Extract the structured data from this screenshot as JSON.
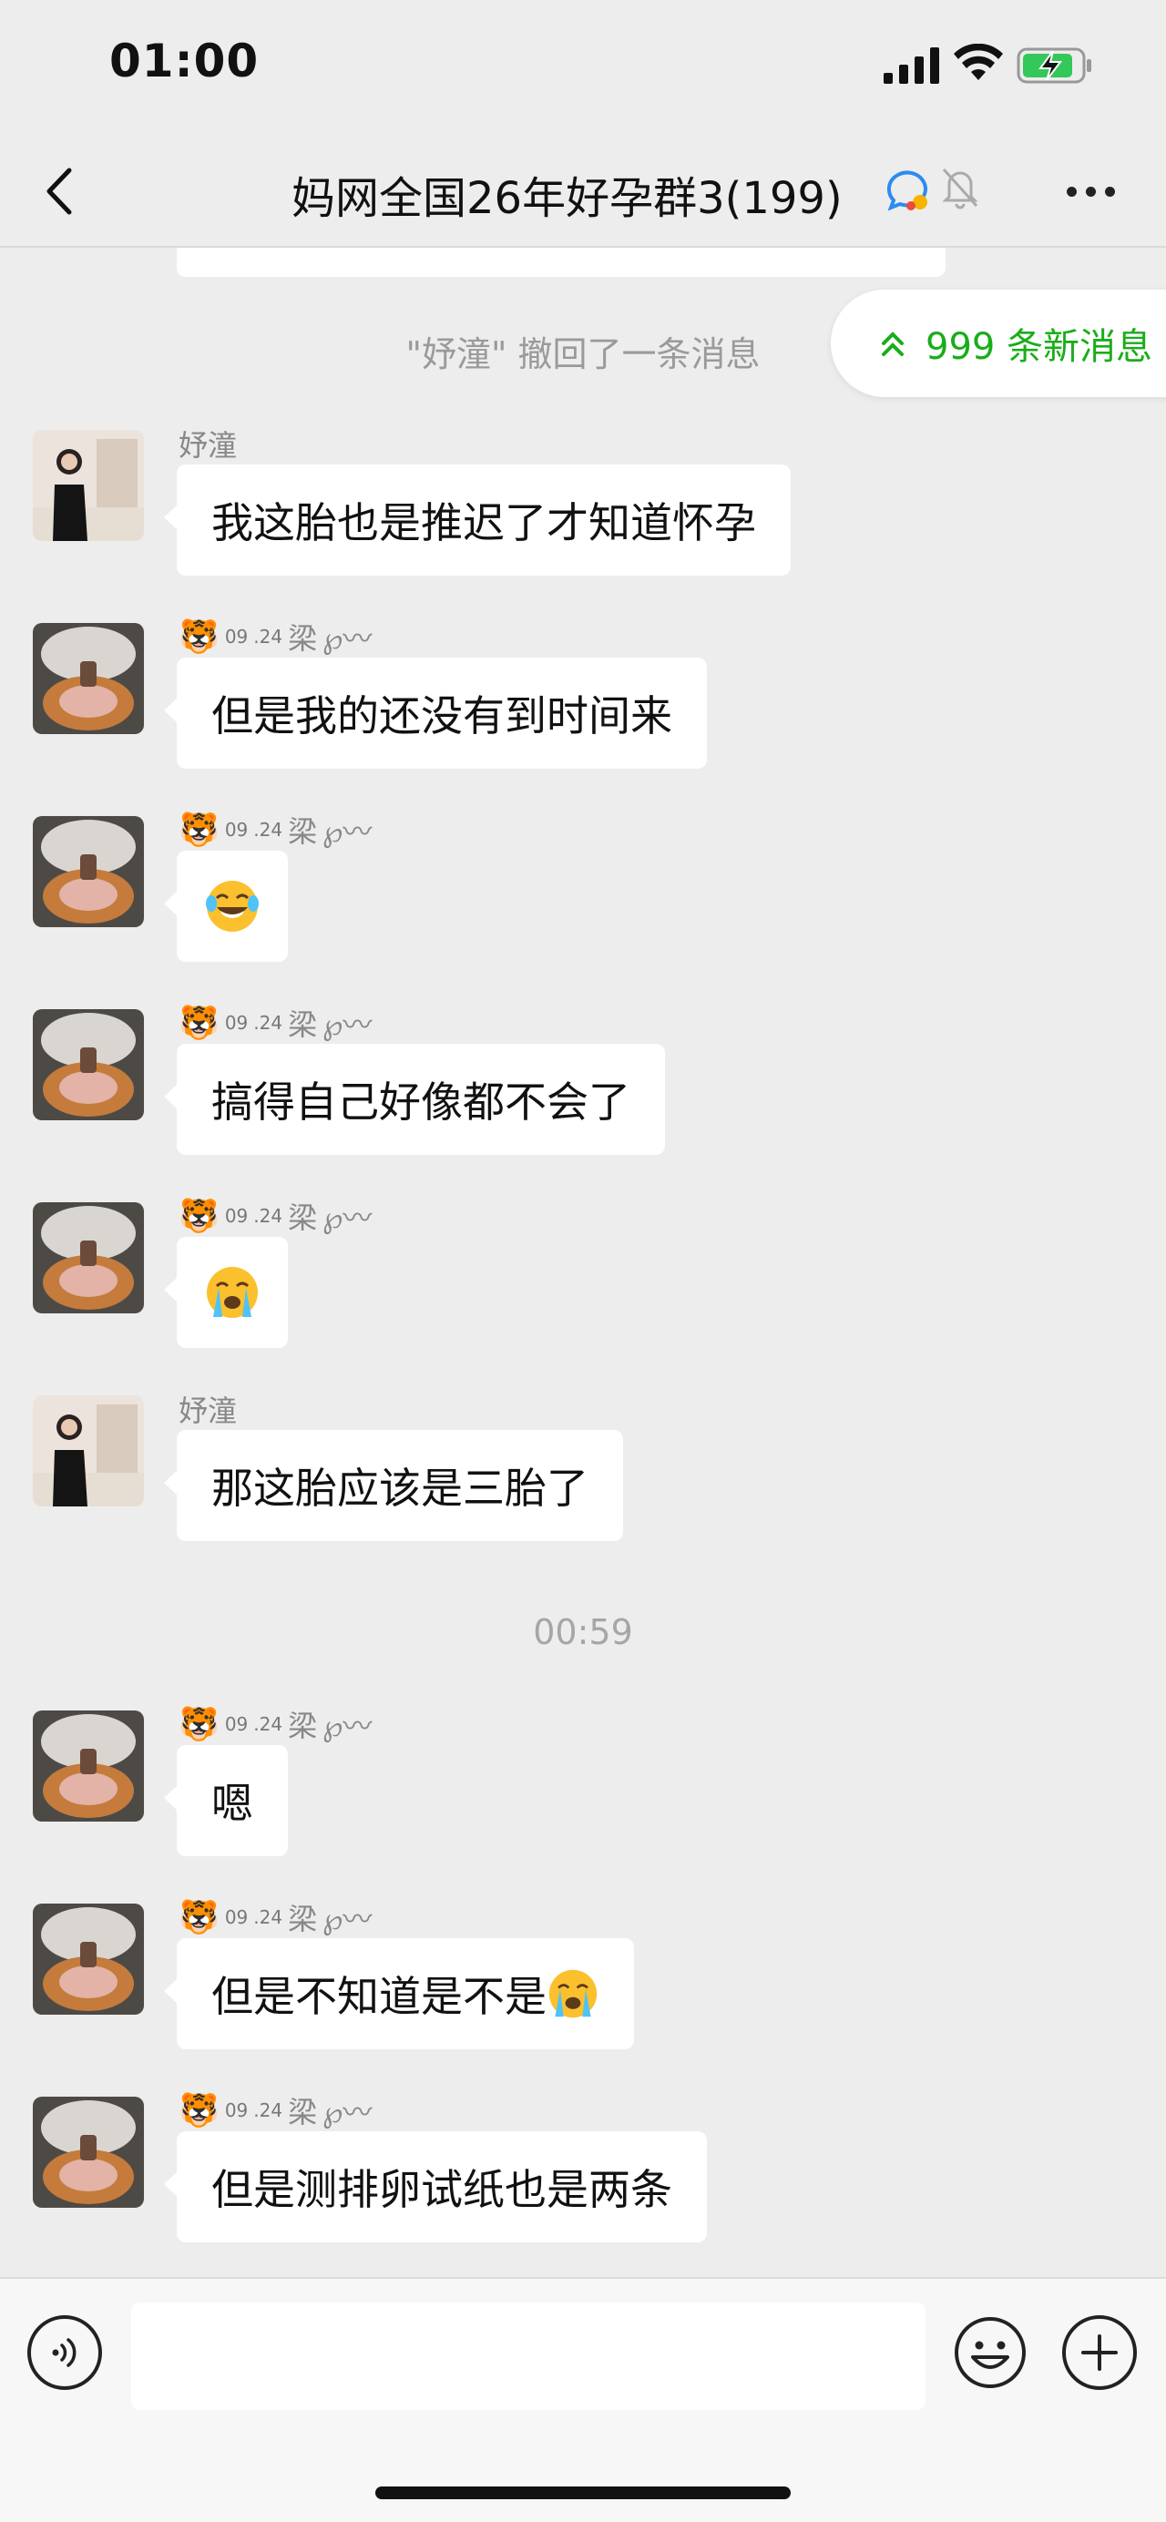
{
  "status_bar": {
    "time": "01:00"
  },
  "nav": {
    "title": "妈网全国26年好孕群3(199)",
    "icons": [
      "back-chevron-icon",
      "group-chat-icon",
      "mute-bell-icon",
      "more-dots-icon"
    ]
  },
  "recall_notice": "\"妤潼\" 撤回了一条消息",
  "new_messages_pill": "999 条新消息",
  "time_separator": "00:59",
  "senders": {
    "a": "妤潼",
    "b_prefix": "🐯",
    "b_sup": "09",
    "b_sub": ".24",
    "b_name": "梁",
    "b_suffix": "℘〰"
  },
  "messages": [
    {
      "sender": "a",
      "text": "我这胎也是推迟了才知道怀孕"
    },
    {
      "sender": "b",
      "text": "但是我的还没有到时间来"
    },
    {
      "sender": "b",
      "emoji": "face-with-tears-of-joy-icon"
    },
    {
      "sender": "b",
      "text": "搞得自己好像都不会了"
    },
    {
      "sender": "b",
      "emoji": "loudly-crying-face-icon"
    },
    {
      "sender": "a",
      "text": "那这胎应该是三胎了"
    },
    {
      "sender": "b",
      "text": "嗯"
    },
    {
      "sender": "b",
      "text": "但是不知道是不是"
    },
    {
      "sender": "b",
      "text": "但是测排卵试纸也是两条"
    }
  ],
  "input_bar": {
    "icons": [
      "voice-icon",
      "emoji-icon",
      "plus-icon"
    ]
  },
  "colors": {
    "accent_green": "#1aad19",
    "chat_bg": "#ededed",
    "bubble_bg": "#ffffff"
  }
}
